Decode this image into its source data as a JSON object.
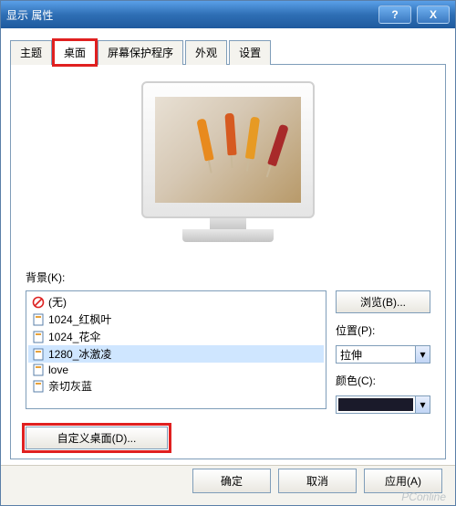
{
  "window": {
    "title": "显示 属性",
    "help_glyph": "?",
    "close_glyph": "X"
  },
  "tabs": [
    {
      "label": "主题"
    },
    {
      "label": "桌面",
      "active": true,
      "highlighted": true
    },
    {
      "label": "屏幕保护程序"
    },
    {
      "label": "外观"
    },
    {
      "label": "设置"
    }
  ],
  "background": {
    "label": "背景(K):",
    "items": [
      {
        "name": "(无)",
        "type": "none"
      },
      {
        "name": "1024_红枫叶",
        "type": "file"
      },
      {
        "name": "1024_花伞",
        "type": "file"
      },
      {
        "name": "1280_冰激凌",
        "type": "file",
        "selected": true
      },
      {
        "name": "love",
        "type": "file"
      },
      {
        "name": "亲切灰蓝",
        "type": "file"
      }
    ]
  },
  "side": {
    "browse_label": "浏览(B)...",
    "position_label": "位置(P):",
    "position_value": "拉伸",
    "color_label": "颜色(C):",
    "color_value": "#1a1a2a"
  },
  "custom_desktop": {
    "label": "自定义桌面(D)..."
  },
  "buttons": {
    "ok": "确定",
    "cancel": "取消",
    "apply": "应用(A)"
  },
  "watermark": "PConline"
}
